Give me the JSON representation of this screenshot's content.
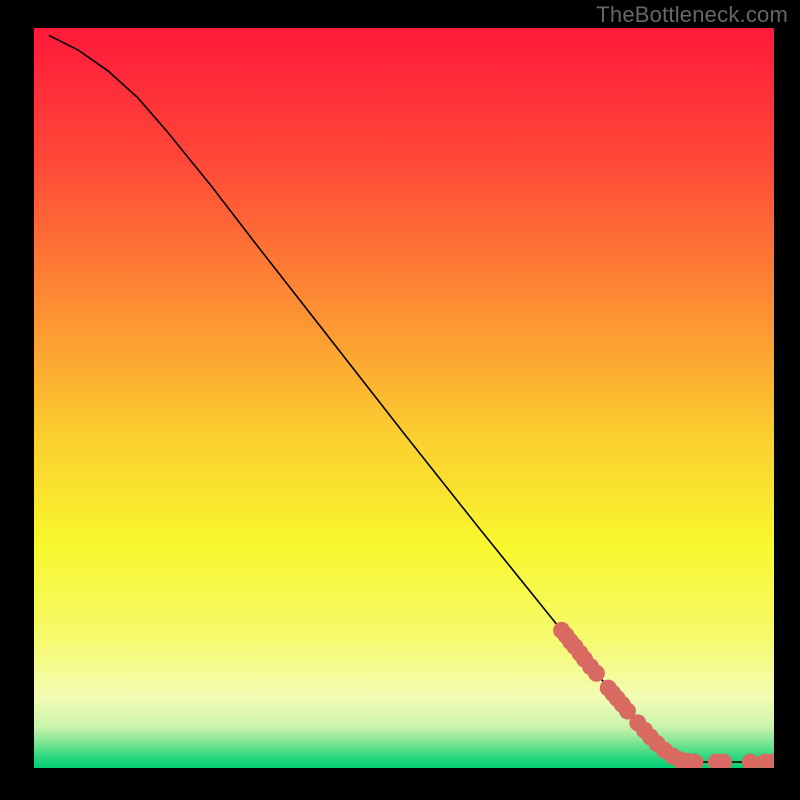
{
  "watermark": "TheBottleneck.com",
  "chart_data": {
    "type": "line",
    "title": "",
    "xlabel": "",
    "ylabel": "",
    "xlim": [
      0,
      100
    ],
    "ylim": [
      0,
      100
    ],
    "background_gradient_stops": [
      {
        "pos": 0.0,
        "color": "#ff193a"
      },
      {
        "pos": 0.18,
        "color": "#ff4838"
      },
      {
        "pos": 0.38,
        "color": "#fd8f33"
      },
      {
        "pos": 0.55,
        "color": "#fbce2f"
      },
      {
        "pos": 0.7,
        "color": "#f8f82d"
      },
      {
        "pos": 0.82,
        "color": "#f6fa69"
      },
      {
        "pos": 0.905,
        "color": "#f3fcb4"
      },
      {
        "pos": 0.945,
        "color": "#c9f3aa"
      },
      {
        "pos": 0.965,
        "color": "#7fe595"
      },
      {
        "pos": 0.985,
        "color": "#2bd77f"
      },
      {
        "pos": 1.0,
        "color": "#00cf73"
      }
    ],
    "series": [
      {
        "name": "curve",
        "type": "line",
        "color": "#000000",
        "points": [
          {
            "x": 2.0,
            "y": 99.0
          },
          {
            "x": 6.0,
            "y": 97.0
          },
          {
            "x": 10.0,
            "y": 94.2
          },
          {
            "x": 14.0,
            "y": 90.6
          },
          {
            "x": 18.0,
            "y": 86.0
          },
          {
            "x": 24.0,
            "y": 78.6
          },
          {
            "x": 30.0,
            "y": 70.8
          },
          {
            "x": 40.0,
            "y": 58.0
          },
          {
            "x": 50.0,
            "y": 45.2
          },
          {
            "x": 60.0,
            "y": 32.6
          },
          {
            "x": 70.0,
            "y": 20.2
          },
          {
            "x": 76.0,
            "y": 12.8
          },
          {
            "x": 80.0,
            "y": 8.0
          },
          {
            "x": 83.0,
            "y": 4.6
          },
          {
            "x": 85.0,
            "y": 2.6
          },
          {
            "x": 87.0,
            "y": 1.4
          },
          {
            "x": 90.0,
            "y": 0.8
          },
          {
            "x": 100.0,
            "y": 0.8
          }
        ]
      },
      {
        "name": "markers",
        "type": "scatter",
        "color": "#d86a62",
        "radius": 8.5,
        "points": [
          {
            "x": 71.3,
            "y": 18.6
          },
          {
            "x": 71.9,
            "y": 17.9
          },
          {
            "x": 72.5,
            "y": 17.1
          },
          {
            "x": 73.1,
            "y": 16.4
          },
          {
            "x": 73.8,
            "y": 15.5
          },
          {
            "x": 74.4,
            "y": 14.7
          },
          {
            "x": 75.2,
            "y": 13.7
          },
          {
            "x": 76.0,
            "y": 12.8
          },
          {
            "x": 77.6,
            "y": 10.8
          },
          {
            "x": 78.2,
            "y": 10.1
          },
          {
            "x": 78.8,
            "y": 9.4
          },
          {
            "x": 79.5,
            "y": 8.6
          },
          {
            "x": 80.2,
            "y": 7.7
          },
          {
            "x": 81.6,
            "y": 6.1
          },
          {
            "x": 82.5,
            "y": 5.1
          },
          {
            "x": 83.3,
            "y": 4.2
          },
          {
            "x": 84.2,
            "y": 3.3
          },
          {
            "x": 85.2,
            "y": 2.4
          },
          {
            "x": 86.3,
            "y": 1.6
          },
          {
            "x": 87.3,
            "y": 1.1
          },
          {
            "x": 88.3,
            "y": 0.9
          },
          {
            "x": 89.3,
            "y": 0.8
          },
          {
            "x": 92.2,
            "y": 0.8
          },
          {
            "x": 93.2,
            "y": 0.8
          },
          {
            "x": 96.8,
            "y": 0.8
          },
          {
            "x": 98.8,
            "y": 0.8
          },
          {
            "x": 99.8,
            "y": 0.8
          }
        ]
      }
    ]
  }
}
